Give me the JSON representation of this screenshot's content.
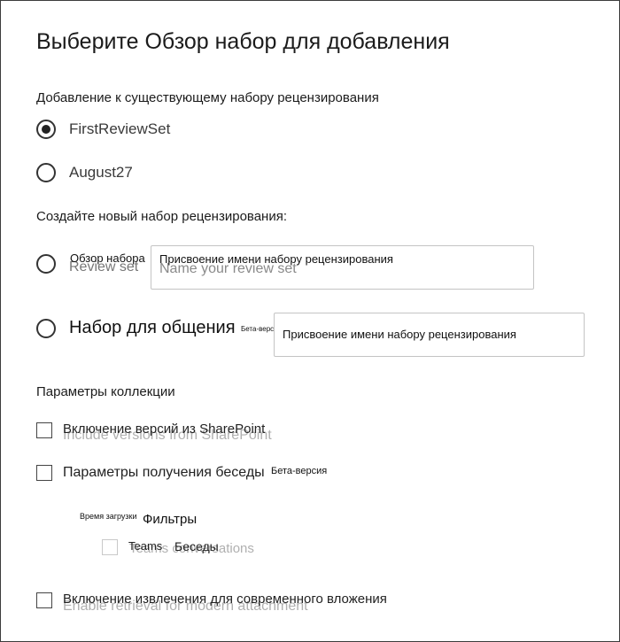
{
  "dialog": {
    "title": "Выберите Обзор набор для добавления"
  },
  "existing_set": {
    "heading": "Добавление к существующему набору рецензирования",
    "options": [
      {
        "label": "FirstReviewSet",
        "selected": true
      },
      {
        "label": "August27",
        "selected": false
      }
    ]
  },
  "new_set": {
    "heading": "Создайте новый набор рецензирования:",
    "review_set": {
      "label": "Обзор набора",
      "label_underlay": "Review set",
      "input_overlay": "Присвоение имени набору рецензирования",
      "input_placeholder": "Name your review set"
    },
    "conversation_set": {
      "label": "Набор для общения",
      "beta": "Бета-версия",
      "input_overlay": "Присвоение имени набору рецензирования"
    }
  },
  "collection_options": {
    "heading": "Параметры коллекции",
    "include_versions": {
      "label": "Включение версий из SharePoint",
      "underlay": "Include versions from SharePoint"
    },
    "conversation_retrieval": {
      "label": "Параметры получения беседы",
      "beta": "Бета-версия",
      "sub": {
        "load_time": "Время загрузки",
        "filters": "Фильтры",
        "teams_label": "Teams",
        "chats_label": "Беседы",
        "teams_underlay": "Teams conversations"
      }
    },
    "modern_attachments": {
      "label": "Включение извлечения для современного вложения",
      "underlay": "Enable retrieval for modern attachment"
    }
  }
}
